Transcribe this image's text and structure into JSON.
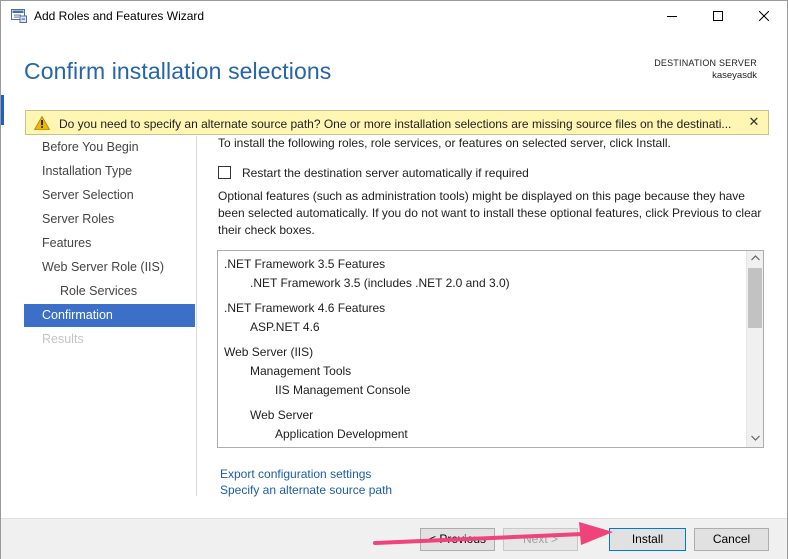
{
  "window": {
    "title": "Add Roles and Features Wizard"
  },
  "header": {
    "title": "Confirm installation selections",
    "destination_label": "DESTINATION SERVER",
    "destination_server": "kaseyasdk"
  },
  "warning": {
    "text": "Do you need to specify an alternate source path? One or more installation selections are missing source files on the destinati..."
  },
  "sidebar": {
    "items": [
      {
        "label": "Before You Begin",
        "state": "normal"
      },
      {
        "label": "Installation Type",
        "state": "normal"
      },
      {
        "label": "Server Selection",
        "state": "normal"
      },
      {
        "label": "Server Roles",
        "state": "normal"
      },
      {
        "label": "Features",
        "state": "normal"
      },
      {
        "label": "Web Server Role (IIS)",
        "state": "normal"
      },
      {
        "label": "Role Services",
        "state": "sub"
      },
      {
        "label": "Confirmation",
        "state": "active"
      },
      {
        "label": "Results",
        "state": "disabled"
      }
    ]
  },
  "main": {
    "intro": "To install the following roles, role services, or features on selected server, click Install.",
    "restart_label": "Restart the destination server automatically if required",
    "restart_checked": false,
    "optional_text": "Optional features (such as administration tools) might be displayed on this page because they have been selected automatically. If you do not want to install these optional features, click Previous to clear their check boxes.",
    "selections": [
      {
        "text": ".NET Framework 3.5 Features",
        "level": 0
      },
      {
        "text": ".NET Framework 3.5 (includes .NET 2.0 and 3.0)",
        "level": 1
      },
      {
        "text": ".NET Framework 4.6 Features",
        "level": 0
      },
      {
        "text": "ASP.NET 4.6",
        "level": 1
      },
      {
        "text": "Web Server (IIS)",
        "level": 0
      },
      {
        "text": "Management Tools",
        "level": 1
      },
      {
        "text": "IIS Management Console",
        "level": 2
      },
      {
        "text": "Web Server",
        "level": 1
      },
      {
        "text": "Application Development",
        "level": 2
      }
    ],
    "export_link": "Export configuration settings",
    "alt_source_link": "Specify an alternate source path"
  },
  "footer": {
    "previous": "< Previous",
    "next": "Next >",
    "install": "Install",
    "cancel": "Cancel"
  },
  "colors": {
    "accent": "#3b6fc8",
    "title_blue": "#2565a8",
    "warning_bg": "#fff6b3",
    "link": "#1d5ca8",
    "annotation_arrow": "#f0437c"
  }
}
